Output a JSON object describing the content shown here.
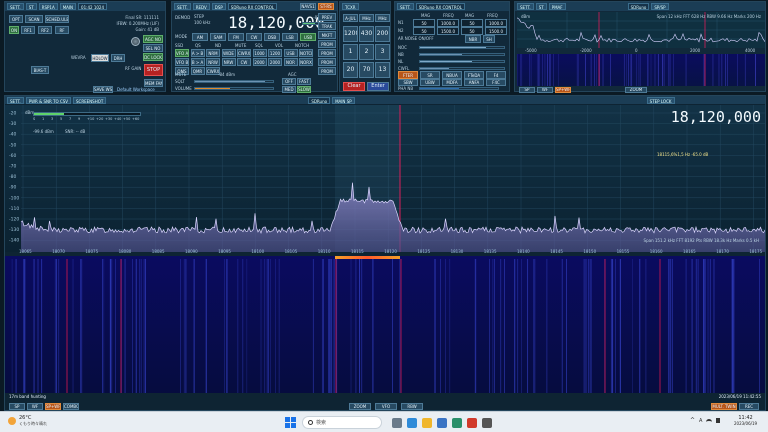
{
  "colors": {
    "accent": "#8fe0ff",
    "marker": "#d81f5a",
    "spectrum": "#c9c2ff",
    "stop": "#b52222",
    "bg": "#0b1a24"
  },
  "top_left": {
    "tabs": [
      "SETT.",
      "ST",
      "RSP1A",
      "MAIN",
      "01:42 1024"
    ],
    "buttons": [
      "OPT",
      "SCAN",
      "SCHED.ULE",
      "ON",
      "RF1",
      "RF2",
      "RF"
    ],
    "info": [
      "Final SR: 111111",
      "IFBW: 0.200MHz (LIF)",
      "Gain: 41 dB"
    ],
    "side_buttons": [
      "RF-MA",
      "RB",
      "ADI",
      "INI",
      "RF GAIN",
      "BEK F/O"
    ],
    "mid_buttons": [
      "WEVRA",
      "HDLOW",
      "DRH"
    ],
    "toggle_buttons": [
      "AGC NO",
      "SEL NO",
      "DC LOCK"
    ],
    "stop_label": "STOP",
    "menu_label": "MEM FAN",
    "bias_label": "BIAS-T",
    "save_label": "SAVE WS",
    "workspace_label": "Default Workspace"
  },
  "rx": {
    "tabs": [
      "SETT.",
      "REDV",
      "DSP",
      "SDRuno RX CONTROL"
    ],
    "demod_label": "DEMOD",
    "step_label": "STEP",
    "step_value": "100 kHz",
    "frequency": "18,120,000",
    "signal_value": "-87.6 dBm",
    "mode_label": "MODE",
    "modes": [
      "AM",
      "SAM",
      "FM",
      "CW",
      "DSB",
      "LSB",
      "USB"
    ],
    "fields_labels": [
      "SSD",
      "QS",
      "ND",
      "MUTE",
      "SQL",
      "VOL",
      "NOTCH"
    ],
    "btn_row2": [
      "VFO A",
      "A > B",
      "NRM",
      "WIDE",
      "CWRX",
      "1000",
      "1200",
      "USB",
      "NOTCH"
    ],
    "btn_row3": [
      "VFO B",
      "B > A",
      "NRW",
      "NRW",
      "CW",
      "2000",
      "2000",
      "NOR",
      "NORX"
    ],
    "btn_row4": [
      "QMS",
      "QMR",
      "CWRX"
    ],
    "audio_label": "-84 dBm",
    "agc_label": "AGC",
    "ag_buttons": [
      "OFF",
      "FAST",
      "MED",
      "SLOW"
    ],
    "mute_label": "MUTE",
    "squelch_label": "SQLT",
    "volume_label": "VOLUME",
    "volume": 0.45,
    "squelch": 0.9,
    "nav_tabs": [
      "NAVS1",
      "ST-RS"
    ],
    "mem_buttons": [
      "PREV",
      "TRAK",
      "MKFT",
      "PROM",
      "PROM",
      "PROM",
      "PROM"
    ]
  },
  "keypad": {
    "title": "TCXR",
    "top": [
      "A-JUL",
      "MHz",
      "MHz"
    ],
    "keys": [
      "1200",
      "430",
      "200",
      "1",
      "2",
      "3",
      "20",
      "70",
      "13"
    ],
    "clear_label": "Clear",
    "enter_label": "Enter"
  },
  "aux": {
    "title": "SDRuno RX CONTROL",
    "tabs": [
      "SETT."
    ],
    "cols": [
      "MAG",
      "FREQ",
      "MAG",
      "FREQ"
    ],
    "rows": [
      {
        "label": "N1",
        "v": [
          "50",
          "1000.0",
          "50",
          "1000.0"
        ]
      },
      {
        "label": "N2",
        "v": [
          "50",
          "1500.0",
          "50",
          "1500.0"
        ]
      }
    ],
    "nr_label": "AR NOISE ON/OFF",
    "nr_buttons": [
      "NBR",
      "SH"
    ],
    "meters": [
      "NOC",
      "NB",
      "NL",
      "CWFL"
    ],
    "bottom_buttons": [
      "FTER",
      "SR",
      "NBUA",
      "FTeDA",
      "F4"
    ],
    "bottom_buttons2": [
      "SBW",
      "UBW",
      "MDFA",
      "ANFA",
      "F4C"
    ],
    "phase_label": "PHA NB"
  },
  "top_right": {
    "tabs": [
      "SETT.",
      "ST",
      "PMAF",
      "SDRuno",
      "SP/SP"
    ],
    "db_label": "dBm",
    "span_text": "Span 12 kHz   FFT 628 Hz   RBW 9.66 Hz   Marks 200 Hz",
    "ticks": [
      "-5000",
      "-2000",
      "0",
      "2000",
      "4000"
    ],
    "bottom_buttons": [
      "SP",
      "WF",
      "SP+WF",
      "ZOOM"
    ]
  },
  "main": {
    "tabs": [
      "SETT.",
      "PWR & SNR TO CSV",
      "SCREENSHOT"
    ],
    "center_tabs": [
      "SDRuno",
      "MAIN SP"
    ],
    "step_lock": "STEP LOCK",
    "frequency": "18,120,000",
    "db_label": "dBm",
    "db_ticks": [
      "20",
      "30",
      "40",
      "50",
      "60",
      "70",
      "80",
      "90",
      "100",
      "110",
      "120",
      "130",
      "140"
    ],
    "meter_value": "-99.6 dBm",
    "snr_value": "SNR: -- dB",
    "s_scale": [
      "S",
      "1",
      "3",
      "5",
      "7",
      "9",
      "+10",
      "+20",
      "+30",
      "+40",
      "+50",
      "+60"
    ],
    "marker_readout": "18115,6%1,5 Hz  -65.0 dB",
    "freq_ticks": [
      "18065",
      "18070",
      "18075",
      "18080",
      "18085",
      "18090",
      "18095",
      "18100",
      "18105",
      "18110",
      "18115",
      "18120",
      "18125",
      "18130",
      "18135",
      "18140",
      "18145",
      "18150",
      "18155",
      "18160",
      "18165",
      "18170",
      "18175"
    ],
    "spectrum_info": "Span 151.2 kHz   FFT 8192 Pts   RBW 18.3k Hz   Marks 0.5 kH",
    "wf_label": "17m band hunting",
    "wf_time": "2023/06/19 11:42:55",
    "bottom_buttons": [
      "SP",
      "WF",
      "SP+WF",
      "COMBO"
    ],
    "zoom_buttons": [
      "ZOOM",
      "VFO",
      "RBW"
    ],
    "right_buttons": [
      "MULT. TWIN",
      "REC"
    ]
  },
  "taskbar": {
    "weather_temp": "26°C",
    "weather_text": "くもり時々晴れ",
    "search_placeholder": "検索",
    "time": "11:42",
    "date": "2023/06/19",
    "tray": "A"
  }
}
